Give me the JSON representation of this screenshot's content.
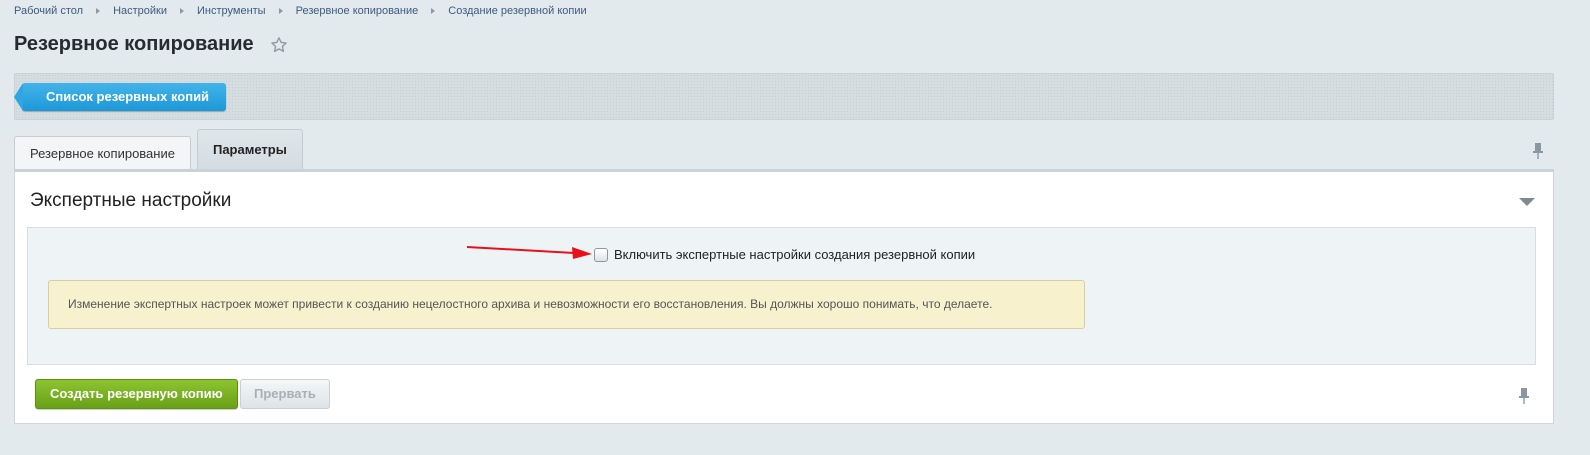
{
  "breadcrumb": {
    "items": [
      "Рабочий стол",
      "Настройки",
      "Инструменты",
      "Резервное копирование",
      "Создание резервной копии"
    ]
  },
  "page": {
    "title": "Резервное копирование"
  },
  "toolbar": {
    "list_button_label": "Список резервных копий"
  },
  "tabs": [
    {
      "label": "Резервное копирование",
      "active": false
    },
    {
      "label": "Параметры",
      "active": true
    }
  ],
  "section": {
    "title": "Экспертные настройки",
    "checkbox_label": "Включить экспертные настройки создания резервной копии",
    "checkbox_checked": false,
    "warning_text": "Изменение экспертных настроек может привести к созданию нецелостного архива и невозможности его восстановления. Вы должны хорошо понимать, что делаете."
  },
  "actions": {
    "create_label": "Создать резервную копию",
    "stop_label": "Прервать"
  },
  "colors": {
    "accent_blue": "#1e98d8",
    "primary_green": "#6aa016",
    "annotation_arrow": "#e8101a",
    "warning_bg": "#f7f1cd"
  }
}
